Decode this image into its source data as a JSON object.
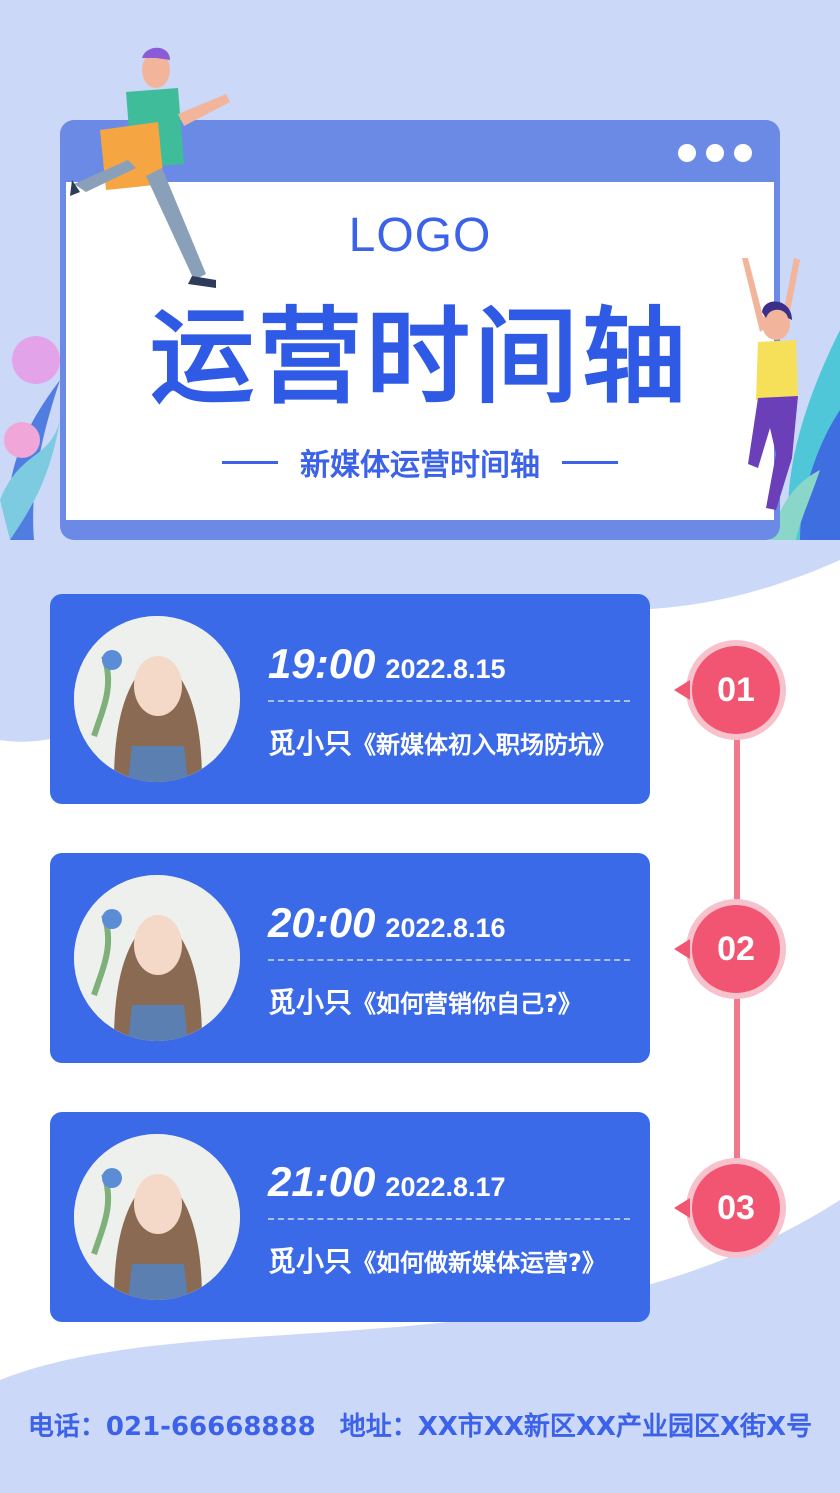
{
  "header": {
    "logo": "LOGO",
    "title": "运营时间轴",
    "subtitle": "新媒体运营时间轴"
  },
  "timeline": [
    {
      "time": "19:00",
      "date": "2022.8.15",
      "name": "觅小只",
      "topic": "《新媒体初入职场防坑》",
      "step": "01"
    },
    {
      "time": "20:00",
      "date": "2022.8.16",
      "name": "觅小只",
      "topic": "《如何营销你自己?》",
      "step": "02"
    },
    {
      "time": "21:00",
      "date": "2022.8.17",
      "name": "觅小只",
      "topic": "《如何做新媒体运营?》",
      "step": "03"
    }
  ],
  "footer": {
    "phone": "电话：021-66668888",
    "address": "地址：XX市XX新区XX产业园区X街X号"
  },
  "colors": {
    "primary": "#3b6ae8",
    "accent": "#f25572",
    "background": "#ccd8f8"
  }
}
